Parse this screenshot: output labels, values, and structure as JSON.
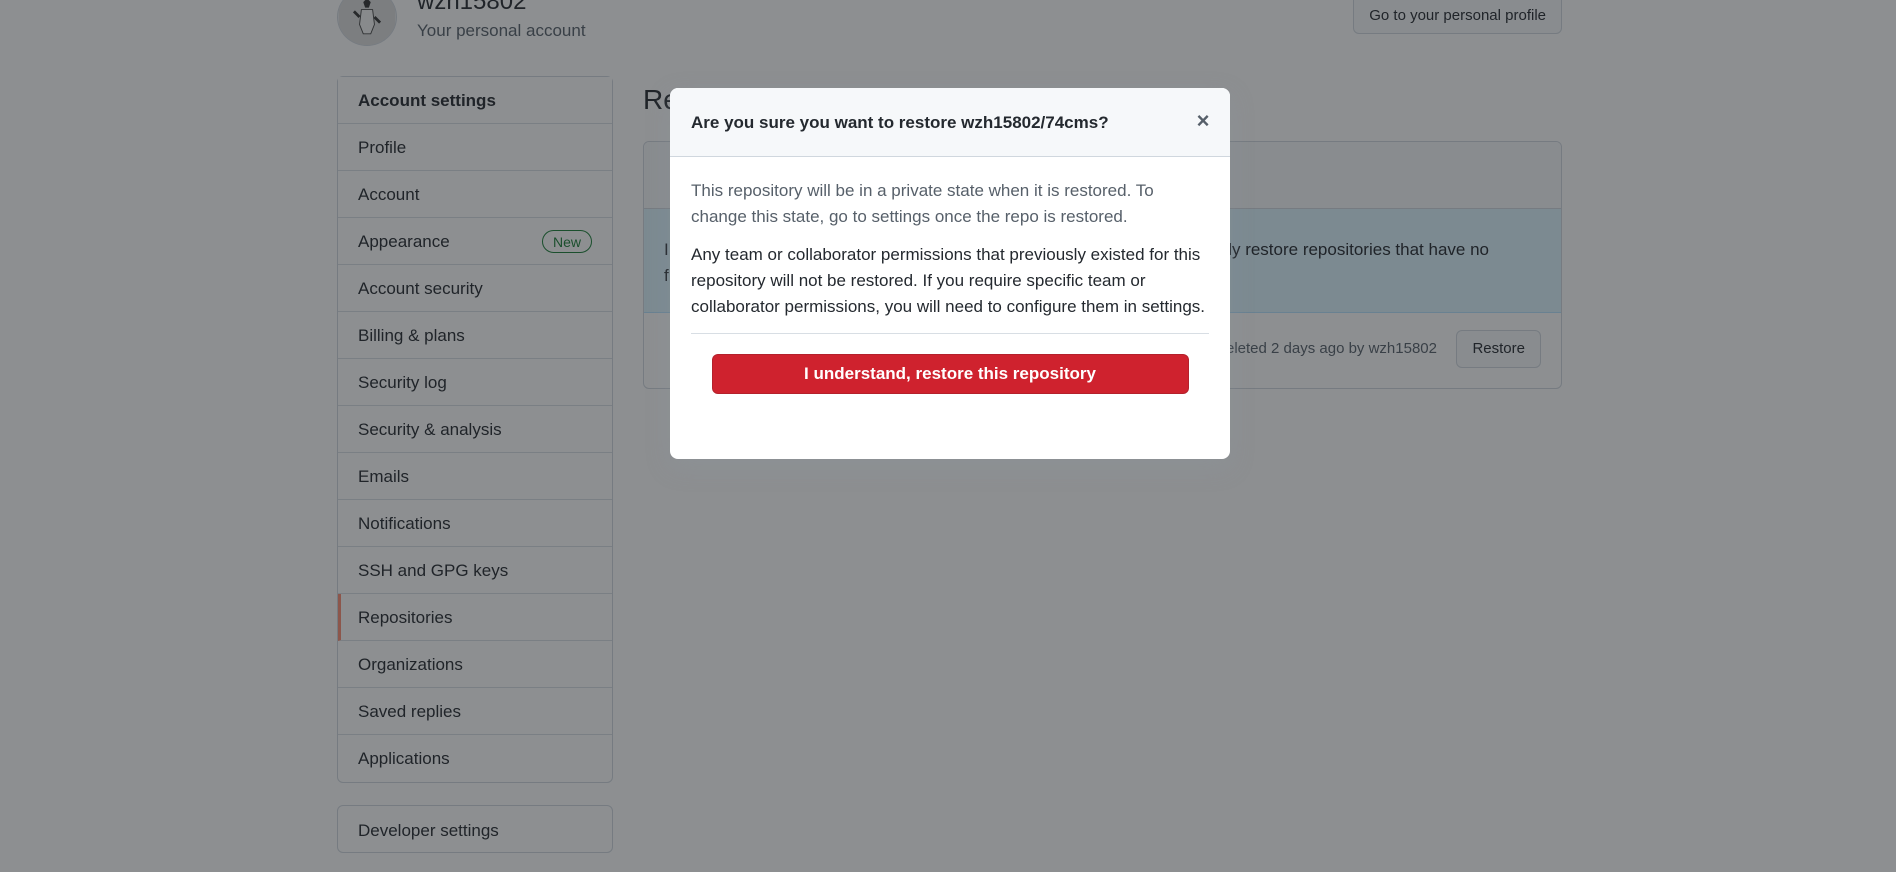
{
  "header": {
    "account_name": "wzh15802",
    "account_subtitle": "Your personal account",
    "profile_button": "Go to your personal profile"
  },
  "sidebar": {
    "heading": "Account settings",
    "items": [
      {
        "label": "Profile"
      },
      {
        "label": "Account"
      },
      {
        "label": "Appearance",
        "badge": "New"
      },
      {
        "label": "Account security"
      },
      {
        "label": "Billing & plans"
      },
      {
        "label": "Security log"
      },
      {
        "label": "Security & analysis"
      },
      {
        "label": "Emails"
      },
      {
        "label": "Notifications"
      },
      {
        "label": "SSH and GPG keys"
      },
      {
        "label": "Repositories",
        "selected": true
      },
      {
        "label": "Organizations"
      },
      {
        "label": "Saved replies"
      },
      {
        "label": "Applications"
      }
    ],
    "developer_settings": "Developer settings"
  },
  "main": {
    "title_visible": "Re",
    "box_header_visible": "",
    "flash_visible_line1_start": "I",
    "flash_visible_line1_end": "nly restore repositories that have no",
    "flash_visible_line2_start": "f",
    "repo_row_visible": "",
    "deleted_meta_visible": "eleted 2 days ago by wzh15802",
    "restore_button": "Restore"
  },
  "dialog": {
    "title": "Are you sure you want to restore wzh15802/74cms?",
    "close_icon": "×",
    "paragraph1": "This repository will be in a private state when it is restored. To change this state, go to settings once the repo is restored.",
    "paragraph2": "Any team or collaborator permissions that previously existed for this repository will not be restored. If you require specific team or collaborator permissions, you will need to configure them in settings.",
    "confirm_button": "I understand, restore this repository"
  },
  "colors": {
    "danger": "#cf222e",
    "selected_accent": "#fd8c73",
    "new_badge": "#1a7f37",
    "flash_bg": "#ddf4ff"
  }
}
